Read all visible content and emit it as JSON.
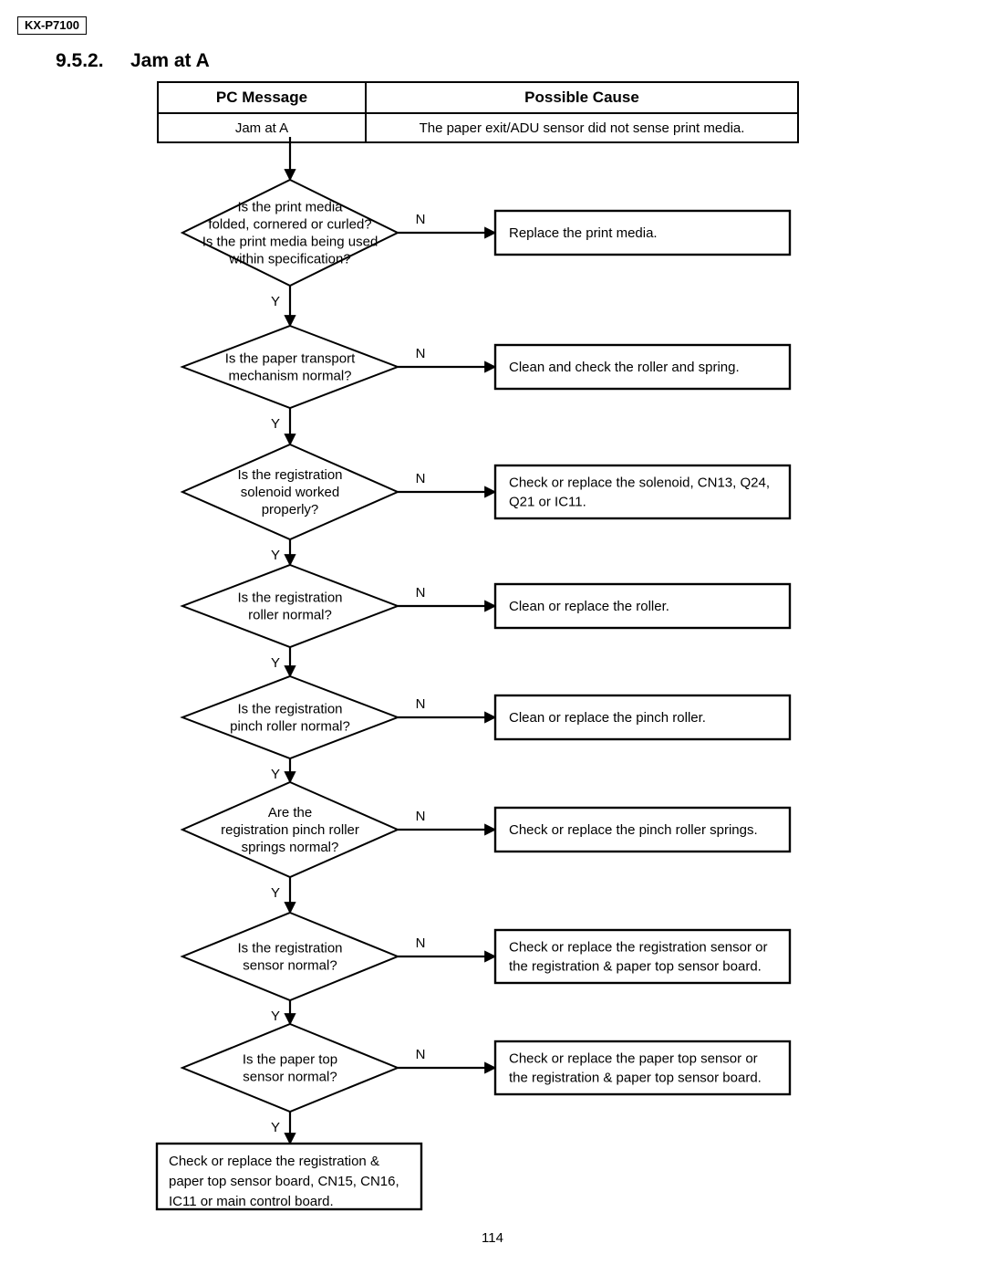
{
  "document": {
    "model": "KX-P7100",
    "section_number": "9.5.2.",
    "section_title": "Jam at A",
    "page_number": "114"
  },
  "table": {
    "headers": [
      "PC Message",
      "Possible Cause"
    ],
    "rows": [
      {
        "pc_message": "Jam at A",
        "possible_cause": "The paper exit/ADU sensor did not sense print media."
      }
    ]
  },
  "flowchart": {
    "yes_label": "Y",
    "no_label": "N",
    "nodes": [
      {
        "id": "q1",
        "lines": [
          "Is the print media",
          "folded, cornered or curled?",
          "Is the print media being used",
          "within specification?"
        ],
        "action": [
          "Replace the print media."
        ]
      },
      {
        "id": "q2",
        "lines": [
          "Is the paper transport",
          "mechanism normal?"
        ],
        "action": [
          "Clean and check the roller and spring."
        ]
      },
      {
        "id": "q3",
        "lines": [
          "Is the registration",
          "solenoid worked",
          "properly?"
        ],
        "action": [
          "Check or replace the solenoid, CN13, Q24,",
          "Q21 or IC11."
        ]
      },
      {
        "id": "q4",
        "lines": [
          "Is the registration",
          "roller normal?"
        ],
        "action": [
          "Clean or replace the roller."
        ]
      },
      {
        "id": "q5",
        "lines": [
          "Is the registration",
          "pinch roller normal?"
        ],
        "action": [
          "Clean or replace the pinch roller."
        ]
      },
      {
        "id": "q6",
        "lines": [
          "Are the",
          "registration pinch roller",
          "springs normal?"
        ],
        "action": [
          "Check or replace the pinch roller springs."
        ]
      },
      {
        "id": "q7",
        "lines": [
          "Is the registration",
          "sensor normal?"
        ],
        "action": [
          "Check or replace the registration sensor or",
          "the registration & paper top sensor board."
        ]
      },
      {
        "id": "q8",
        "lines": [
          "Is the paper top",
          "sensor normal?"
        ],
        "action": [
          "Check or replace the paper top sensor or",
          "the registration & paper top sensor board."
        ]
      }
    ],
    "terminal": {
      "lines": [
        "Check or replace the registration &",
        "paper top sensor board, CN15, CN16,",
        "IC11 or main control board."
      ]
    }
  }
}
